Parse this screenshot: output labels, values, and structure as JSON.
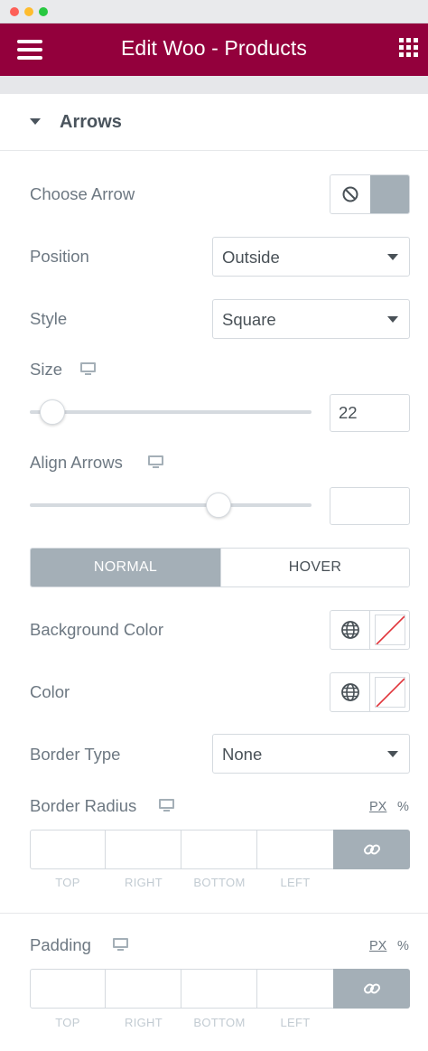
{
  "header": {
    "title": "Edit Woo - Products"
  },
  "section": {
    "title": "Arrows"
  },
  "controls": {
    "choose_arrow": {
      "label": "Choose Arrow"
    },
    "position": {
      "label": "Position",
      "value": "Outside"
    },
    "style": {
      "label": "Style",
      "value": "Square"
    },
    "size": {
      "label": "Size",
      "value": "22",
      "slider_fraction": 0.08
    },
    "align_arrows": {
      "label": "Align Arrows",
      "value": "",
      "slider_fraction": 0.67
    },
    "tabs": {
      "normal": "NORMAL",
      "hover": "HOVER",
      "active": "normal"
    },
    "background_color": {
      "label": "Background Color"
    },
    "color": {
      "label": "Color"
    },
    "border_type": {
      "label": "Border Type",
      "value": "None"
    },
    "border_radius": {
      "label": "Border Radius",
      "unit_px": "PX",
      "unit_pct": "%",
      "dims": [
        "TOP",
        "RIGHT",
        "BOTTOM",
        "LEFT"
      ]
    },
    "padding": {
      "label": "Padding",
      "unit_px": "PX",
      "unit_pct": "%",
      "dims": [
        "TOP",
        "RIGHT",
        "BOTTOM",
        "LEFT"
      ]
    }
  },
  "colors": {
    "header_bg": "#93003c",
    "active_gray": "#a4afb7",
    "border": "#d5dadf"
  },
  "icons": {
    "menu": "hamburger-icon",
    "apps": "grid-icon",
    "none": "ban-icon",
    "responsive": "desktop-icon",
    "global": "globe-icon",
    "link": "link-icon"
  }
}
